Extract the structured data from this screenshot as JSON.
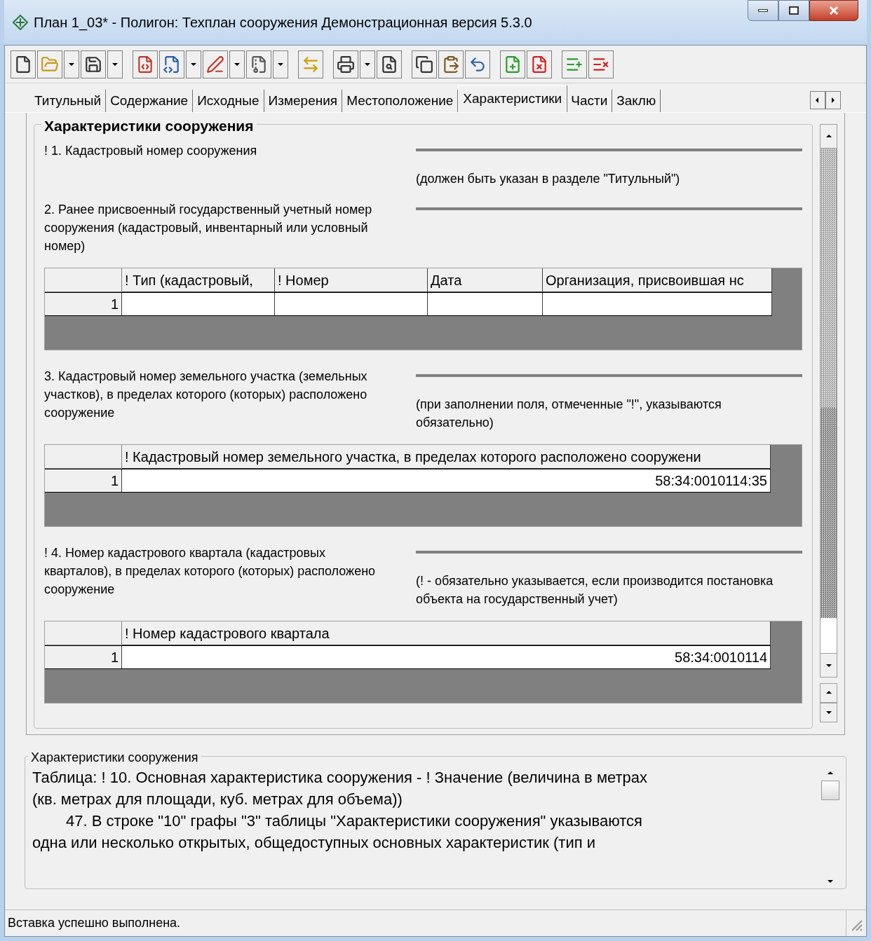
{
  "window": {
    "title": "План 1_03* - Полигон: Техплан сооружения Демонстрационная версия 5.3.0"
  },
  "tabs": [
    {
      "label": "Титульный",
      "selected": false
    },
    {
      "label": "Содержание",
      "selected": false
    },
    {
      "label": "Исходные",
      "selected": false
    },
    {
      "label": "Измерения",
      "selected": false
    },
    {
      "label": "Местоположение",
      "selected": false
    },
    {
      "label": "Характеристики",
      "selected": true
    },
    {
      "label": "Части",
      "selected": false
    },
    {
      "label": "Заклю",
      "selected": false
    }
  ],
  "group_title": "Характеристики сооружения",
  "sections": [
    {
      "label": "! 1. Кадастровый номер сооружения",
      "note": "(должен быть указан в разделе \"Титульный\")"
    },
    {
      "label": "2. Ранее присвоенный государственный учетный номер сооружения (кадастровый, инвентарный или условный номер)",
      "table": {
        "columns": [
          "! Тип (кадастровый,",
          "! Номер",
          "Дата",
          "Организация, присвоившая нс"
        ],
        "rows": [
          {
            "number": "1"
          }
        ]
      }
    },
    {
      "label": "3. Кадастровый номер земельного участка (земельных участков), в пределах которого (которых) расположено сооружение",
      "note": "(при заполнении поля, отмеченные \"!\", указываются обязательно)",
      "table": {
        "columns": [
          "! Кадастровый номер земельного участка, в пределах которого расположено сооружени"
        ],
        "rows": [
          {
            "number": "1",
            "cells": [
              "58:34:0010114:35"
            ]
          }
        ]
      }
    },
    {
      "label": "! 4. Номер кадастрового квартала (кадастровых кварталов), в пределах которого (которых) расположено сооружение",
      "note": "(! - обязательно указывается, если производится постановка объекта на государственный учет)",
      "table": {
        "columns": [
          "! Номер кадастрового квартала"
        ],
        "rows": [
          {
            "number": "1",
            "cells": [
              "58:34:0010114"
            ]
          }
        ]
      }
    }
  ],
  "help": {
    "title": "Характеристики сооружения",
    "lines": [
      {
        "text": "Таблица: ! 10. Основная характеристика сооружения - ! Значение (величина в метрах",
        "indent": false
      },
      {
        "text": "(кв. метрах для площади, куб. метрах для объема))",
        "indent": false
      },
      {
        "text": "47. В строке \"10\" графы \"3\" таблицы \"Характеристики сооружения\" указываются",
        "indent": true
      },
      {
        "text": "одна или несколько открытых, общедоступных основных характеристик (тип и",
        "indent": false
      }
    ]
  },
  "status_bar": "Вставка успешно выполнена."
}
